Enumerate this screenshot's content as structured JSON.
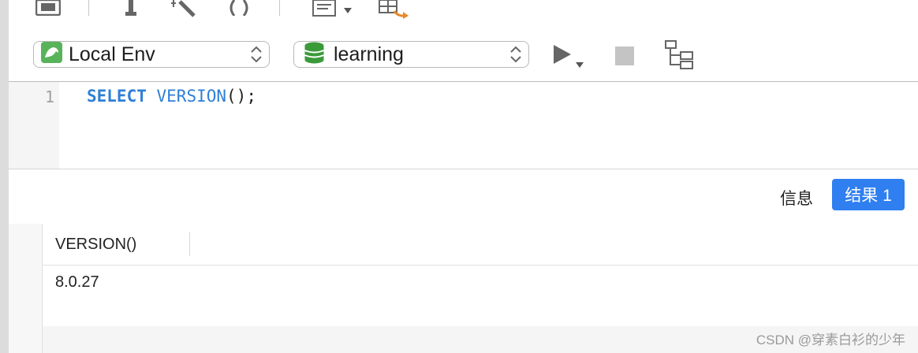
{
  "toolbar": {
    "icons": [
      "save-icon",
      "pin-icon",
      "magic-wand-icon",
      "brackets-icon",
      "document-menu-icon",
      "table-export-icon"
    ]
  },
  "connection": {
    "selected": "Local Env",
    "icon": "mysql-dolphin-icon"
  },
  "database": {
    "selected": "learning",
    "icon": "database-icon"
  },
  "editor": {
    "line_number": "1",
    "keyword": "SELECT",
    "function": "VERSION",
    "punct": "();"
  },
  "tabs": {
    "info": "信息",
    "result": "结果 1"
  },
  "result": {
    "columns": [
      "VERSION()"
    ],
    "rows": [
      [
        "8.0.27"
      ]
    ]
  },
  "watermark": "CSDN @穿素白衫的少年",
  "colors": {
    "accent": "#2f7ff0",
    "keyword": "#2f7fd6",
    "db_green": "#3a9a3a"
  }
}
